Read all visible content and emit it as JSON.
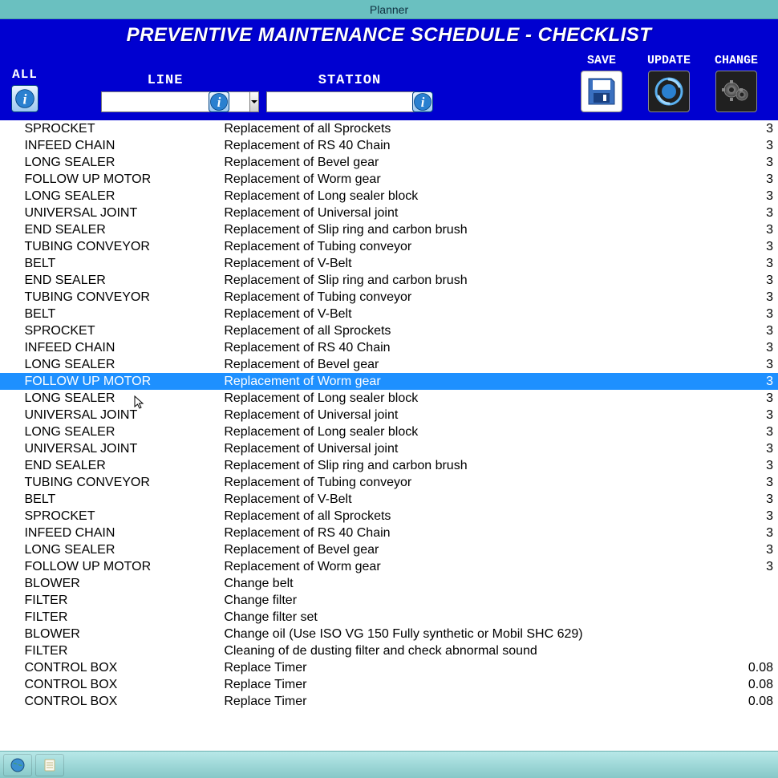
{
  "window": {
    "title": "Planner"
  },
  "header": {
    "title": "PREVENTIVE MAINTENANCE SCHEDULE - CHECKLIST"
  },
  "toolbar": {
    "all_label": "ALL",
    "line_label": "LINE",
    "line_value": "",
    "station_label": "STATION",
    "station_value": "",
    "save_label": "SAVE",
    "update_label": "UPDATE",
    "change_label": "CHANGE"
  },
  "rows": [
    {
      "component": "SPROCKET",
      "task": "Replacement of all Sprockets",
      "val": "3"
    },
    {
      "component": "INFEED CHAIN",
      "task": "Replacement of RS 40 Chain",
      "val": "3"
    },
    {
      "component": "LONG SEALER",
      "task": "Replacement of Bevel gear",
      "val": "3"
    },
    {
      "component": "FOLLOW UP MOTOR",
      "task": "Replacement of Worm gear",
      "val": "3"
    },
    {
      "component": "LONG SEALER",
      "task": "Replacement of Long sealer block",
      "val": "3"
    },
    {
      "component": "UNIVERSAL JOINT",
      "task": "Replacement of Universal joint",
      "val": "3"
    },
    {
      "component": "END SEALER",
      "task": "Replacement of Slip ring and carbon brush",
      "val": "3"
    },
    {
      "component": "TUBING CONVEYOR",
      "task": "Replacement of Tubing conveyor",
      "val": "3"
    },
    {
      "component": "BELT",
      "task": "Replacement of V-Belt",
      "val": "3"
    },
    {
      "component": "END SEALER",
      "task": "Replacement of Slip ring and carbon brush",
      "val": "3"
    },
    {
      "component": "TUBING CONVEYOR",
      "task": "Replacement of Tubing conveyor",
      "val": "3"
    },
    {
      "component": "BELT",
      "task": "Replacement of V-Belt",
      "val": "3"
    },
    {
      "component": "SPROCKET",
      "task": "Replacement of all Sprockets",
      "val": "3"
    },
    {
      "component": "INFEED CHAIN",
      "task": "Replacement of RS 40 Chain",
      "val": "3"
    },
    {
      "component": "LONG SEALER",
      "task": "Replacement of Bevel gear",
      "val": "3"
    },
    {
      "component": "FOLLOW UP MOTOR",
      "task": "Replacement of Worm gear",
      "val": "3",
      "selected": true
    },
    {
      "component": "LONG SEALER",
      "task": "Replacement of Long sealer block",
      "val": "3"
    },
    {
      "component": "UNIVERSAL JOINT",
      "task": "Replacement of Universal joint",
      "val": "3"
    },
    {
      "component": "LONG SEALER",
      "task": "Replacement of Long sealer block",
      "val": "3"
    },
    {
      "component": "UNIVERSAL JOINT",
      "task": "Replacement of Universal joint",
      "val": "3"
    },
    {
      "component": "END SEALER",
      "task": "Replacement of Slip ring and carbon brush",
      "val": "3"
    },
    {
      "component": "TUBING CONVEYOR",
      "task": "Replacement of Tubing conveyor",
      "val": "3"
    },
    {
      "component": "BELT",
      "task": "Replacement of V-Belt",
      "val": "3"
    },
    {
      "component": "SPROCKET",
      "task": "Replacement of all Sprockets",
      "val": "3"
    },
    {
      "component": "INFEED CHAIN",
      "task": "Replacement of RS 40 Chain",
      "val": "3"
    },
    {
      "component": "LONG SEALER",
      "task": "Replacement of Bevel gear",
      "val": "3"
    },
    {
      "component": "FOLLOW UP MOTOR",
      "task": "Replacement of Worm gear",
      "val": "3"
    },
    {
      "component": "BLOWER",
      "task": "Change belt",
      "val": ""
    },
    {
      "component": "FILTER",
      "task": "Change filter",
      "val": ""
    },
    {
      "component": "FILTER",
      "task": "Change filter set",
      "val": ""
    },
    {
      "component": "BLOWER",
      "task": "Change oil (Use ISO VG 150 Fully synthetic or Mobil SHC 629)",
      "val": ""
    },
    {
      "component": "FILTER",
      "task": "Cleaning of de dusting filter and check abnormal sound",
      "val": ""
    },
    {
      "component": "CONTROL BOX",
      "task": "Replace Timer",
      "val": "0.08"
    },
    {
      "component": "CONTROL BOX",
      "task": "Replace Timer",
      "val": "0.08"
    },
    {
      "component": "CONTROL BOX",
      "task": "Replace Timer",
      "val": "0.08"
    }
  ],
  "icons": {
    "info": "info-icon",
    "save": "save-icon",
    "update": "update-icon",
    "change": "change-icon"
  },
  "colors": {
    "header_bg": "#0000d0",
    "selection": "#1e90ff",
    "teal": "#6ac0c0"
  }
}
